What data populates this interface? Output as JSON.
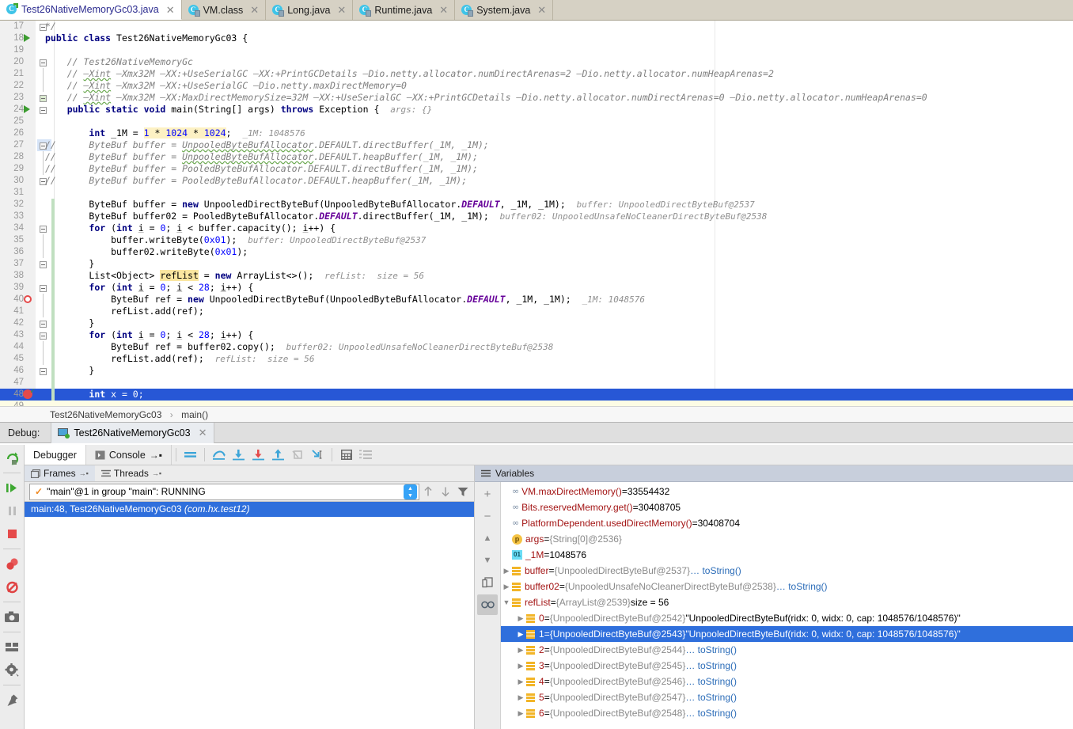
{
  "editor_tabs": [
    {
      "label": "Test26NativeMemoryGc03.java",
      "active": true,
      "icon": "java-class-run-icon"
    },
    {
      "label": "VM.class",
      "active": false,
      "icon": "java-class-icon"
    },
    {
      "label": "Long.java",
      "active": false,
      "icon": "java-class-icon"
    },
    {
      "label": "Runtime.java",
      "active": false,
      "icon": "java-class-icon"
    },
    {
      "label": "System.java",
      "active": false,
      "icon": "java-class-icon"
    }
  ],
  "code_lines": [
    {
      "num": "17",
      "mark": "",
      "fold": "end",
      "html": "<span class=\"cmt\">*/</span>"
    },
    {
      "num": "18",
      "mark": "run",
      "fold": "",
      "html": "<span class=\"kw\">public class</span> Test26NativeMemoryGc03 {"
    },
    {
      "num": "19",
      "mark": "",
      "fold": "",
      "html": ""
    },
    {
      "num": "20",
      "mark": "",
      "fold": "start",
      "html": "&nbsp;&nbsp;&nbsp;&nbsp;<span class=\"cmt\">// Test26NativeMemoryGc</span>"
    },
    {
      "num": "21",
      "mark": "",
      "fold": "line",
      "html": "&nbsp;&nbsp;&nbsp;&nbsp;<span class=\"cmt\">// <span class=\"sq\">–Xint</span> –Xmx32M –XX:+UseSerialGC –XX:+PrintGCDetails –Dio.netty.allocator.numDirectArenas=2 –Dio.netty.allocator.numHeapArenas=2</span>"
    },
    {
      "num": "22",
      "mark": "",
      "fold": "line",
      "html": "&nbsp;&nbsp;&nbsp;&nbsp;<span class=\"cmt\">// <span class=\"sq\">–Xint</span> –Xmx32M –XX:+UseSerialGC –Dio.netty.maxDirectMemory=0</span>"
    },
    {
      "num": "23",
      "mark": "",
      "fold": "endg",
      "html": "&nbsp;&nbsp;&nbsp;&nbsp;<span class=\"cmt\">// <span class=\"sq\">–Xint</span> –Xmx32M –XX:MaxDirectMemorySize=32M –XX:+UseSerialGC –XX:+PrintGCDetails –Dio.netty.allocator.numDirectArenas=0 –Dio.netty.allocator.numHeapArenas=0</span>"
    },
    {
      "num": "24",
      "mark": "run",
      "fold": "start",
      "html": "&nbsp;&nbsp;&nbsp;&nbsp;<span class=\"kw\">public static void</span> main(String[] args) <span class=\"kw\">throws</span> Exception {&nbsp;&nbsp;<span class=\"hint\">args: {}</span>"
    },
    {
      "num": "25",
      "mark": "",
      "fold": "",
      "html": ""
    },
    {
      "num": "26",
      "mark": "",
      "fold": "",
      "html": "&nbsp;&nbsp;&nbsp;&nbsp;&nbsp;&nbsp;&nbsp;&nbsp;<span class=\"kw\">int</span> _1M = <span class=\"hlbg\"><span class=\"num\">1</span> * <span class=\"num\">1024</span> * <span class=\"num\">1024</span></span>;&nbsp;&nbsp;<span class=\"hint\">_1M: 1048576</span>"
    },
    {
      "num": "27",
      "mark": "",
      "fold": "startsel",
      "html": "<span class=\"cmt\">//</span>&nbsp;&nbsp;&nbsp;&nbsp;&nbsp;&nbsp;<span class=\"cmt\">ByteBuf buffer = <span class=\"sq\">UnpooledByteBufAllocator</span>.DEFAULT.directBuffer(_1M, _1M);</span>"
    },
    {
      "num": "28",
      "mark": "",
      "fold": "line2",
      "html": "<span class=\"cmt\">//</span>&nbsp;&nbsp;&nbsp;&nbsp;&nbsp;&nbsp;<span class=\"cmt\">ByteBuf buffer = <span class=\"sq\">UnpooledByteBufAllocator</span>.DEFAULT.heapBuffer(_1M, _1M);</span>"
    },
    {
      "num": "29",
      "mark": "",
      "fold": "line2",
      "html": "<span class=\"cmt\">//</span>&nbsp;&nbsp;&nbsp;&nbsp;&nbsp;&nbsp;<span class=\"cmt\">ByteBuf buffer = PooledByteBufAllocator.DEFAULT.directBuffer(_1M, _1M);</span>"
    },
    {
      "num": "30",
      "mark": "",
      "fold": "end2",
      "html": "<span class=\"cmt\">//</span>&nbsp;&nbsp;&nbsp;&nbsp;&nbsp;&nbsp;<span class=\"cmt\">ByteBuf buffer = PooledByteBufAllocator.DEFAULT.heapBuffer(_1M, _1M);</span>"
    },
    {
      "num": "31",
      "mark": "",
      "fold": "",
      "html": ""
    },
    {
      "num": "32",
      "mark": "",
      "fold": "",
      "stripe": true,
      "html": "&nbsp;&nbsp;&nbsp;&nbsp;&nbsp;&nbsp;&nbsp;&nbsp;ByteBuf buffer = <span class=\"kw\">new</span> UnpooledDirectByteBuf(UnpooledByteBufAllocator.<span class=\"stat\">DEFAULT</span>, _1M, _1M);&nbsp;&nbsp;<span class=\"hint\">buffer: UnpooledDirectByteBuf@2537</span>"
    },
    {
      "num": "33",
      "mark": "",
      "fold": "",
      "stripe": true,
      "html": "&nbsp;&nbsp;&nbsp;&nbsp;&nbsp;&nbsp;&nbsp;&nbsp;ByteBuf buffer02 = PooledByteBufAllocator.<span class=\"stat\">DEFAULT</span>.directBuffer(_1M, _1M);&nbsp;&nbsp;<span class=\"hint\">buffer02: UnpooledUnsafeNoCleanerDirectByteBuf@2538</span>"
    },
    {
      "num": "34",
      "mark": "",
      "fold": "start",
      "stripe": true,
      "html": "&nbsp;&nbsp;&nbsp;&nbsp;&nbsp;&nbsp;&nbsp;&nbsp;<span class=\"kw\">for</span> (<span class=\"kw\">int</span> <span class=\"var-u\">i</span> = <span class=\"num\">0</span>; <span class=\"var-u\">i</span> &lt; buffer.capacity(); <span class=\"var-u\">i</span>++) {"
    },
    {
      "num": "35",
      "mark": "",
      "fold": "line",
      "stripe": true,
      "html": "&nbsp;&nbsp;&nbsp;&nbsp;&nbsp;&nbsp;&nbsp;&nbsp;&nbsp;&nbsp;&nbsp;&nbsp;buffer.writeByte(<span class=\"num\">0x01</span>);&nbsp;&nbsp;<span class=\"hint\">buffer: UnpooledDirectByteBuf@2537</span>"
    },
    {
      "num": "36",
      "mark": "",
      "fold": "line",
      "stripe": true,
      "html": "&nbsp;&nbsp;&nbsp;&nbsp;&nbsp;&nbsp;&nbsp;&nbsp;&nbsp;&nbsp;&nbsp;&nbsp;buffer02.writeByte(<span class=\"num\">0x01</span>);"
    },
    {
      "num": "37",
      "mark": "",
      "fold": "end",
      "stripe": true,
      "html": "&nbsp;&nbsp;&nbsp;&nbsp;&nbsp;&nbsp;&nbsp;&nbsp;}"
    },
    {
      "num": "38",
      "mark": "",
      "fold": "",
      "stripe": true,
      "html": "&nbsp;&nbsp;&nbsp;&nbsp;&nbsp;&nbsp;&nbsp;&nbsp;List&lt;Object&gt; <span class=\"searchbg\">refList</span> = <span class=\"kw\">new</span> ArrayList&lt;&gt;();&nbsp;&nbsp;<span class=\"hint\">refList:&nbsp;&nbsp;size = 56</span>"
    },
    {
      "num": "39",
      "mark": "",
      "fold": "start",
      "stripe": true,
      "html": "&nbsp;&nbsp;&nbsp;&nbsp;&nbsp;&nbsp;&nbsp;&nbsp;<span class=\"kw\">for</span> (<span class=\"kw\">int</span> <span class=\"var-u\">i</span> = <span class=\"num\">0</span>; <span class=\"var-u\">i</span> &lt; <span class=\"num\">28</span>; <span class=\"var-u\">i</span>++) {"
    },
    {
      "num": "40",
      "mark": "bp-dis",
      "fold": "line",
      "stripe": true,
      "html": "&nbsp;&nbsp;&nbsp;&nbsp;&nbsp;&nbsp;&nbsp;&nbsp;&nbsp;&nbsp;&nbsp;&nbsp;ByteBuf ref = <span class=\"kw\">new</span> UnpooledDirectByteBuf(UnpooledByteBufAllocator.<span class=\"stat\">DEFAULT</span>, _1M, _1M);&nbsp;&nbsp;<span class=\"hint\">_1M: 1048576</span>"
    },
    {
      "num": "41",
      "mark": "",
      "fold": "line",
      "stripe": true,
      "html": "&nbsp;&nbsp;&nbsp;&nbsp;&nbsp;&nbsp;&nbsp;&nbsp;&nbsp;&nbsp;&nbsp;&nbsp;refList.add(ref);"
    },
    {
      "num": "42",
      "mark": "",
      "fold": "end",
      "stripe": true,
      "html": "&nbsp;&nbsp;&nbsp;&nbsp;&nbsp;&nbsp;&nbsp;&nbsp;}"
    },
    {
      "num": "43",
      "mark": "",
      "fold": "start",
      "stripe": true,
      "html": "&nbsp;&nbsp;&nbsp;&nbsp;&nbsp;&nbsp;&nbsp;&nbsp;<span class=\"kw\">for</span> (<span class=\"kw\">int</span> <span class=\"var-u\">i</span> = <span class=\"num\">0</span>; <span class=\"var-u\">i</span> &lt; <span class=\"num\">28</span>; <span class=\"var-u\">i</span>++) {"
    },
    {
      "num": "44",
      "mark": "",
      "fold": "line",
      "stripe": true,
      "html": "&nbsp;&nbsp;&nbsp;&nbsp;&nbsp;&nbsp;&nbsp;&nbsp;&nbsp;&nbsp;&nbsp;&nbsp;ByteBuf ref = buffer02.copy();&nbsp;&nbsp;<span class=\"hint\">buffer02: UnpooledUnsafeNoCleanerDirectByteBuf@2538</span>"
    },
    {
      "num": "45",
      "mark": "",
      "fold": "line",
      "stripe": true,
      "html": "&nbsp;&nbsp;&nbsp;&nbsp;&nbsp;&nbsp;&nbsp;&nbsp;&nbsp;&nbsp;&nbsp;&nbsp;refList.add(ref);&nbsp;&nbsp;<span class=\"hint\">refList:&nbsp;&nbsp;size = 56</span>"
    },
    {
      "num": "46",
      "mark": "",
      "fold": "end",
      "stripe": true,
      "html": "&nbsp;&nbsp;&nbsp;&nbsp;&nbsp;&nbsp;&nbsp;&nbsp;}"
    },
    {
      "num": "47",
      "mark": "",
      "fold": "",
      "stripe": true,
      "html": ""
    },
    {
      "num": "48",
      "mark": "bp-on",
      "fold": "",
      "stripe": true,
      "hl": true,
      "html": "&nbsp;&nbsp;&nbsp;&nbsp;&nbsp;&nbsp;&nbsp;&nbsp;<span class=\"kw\">int</span> x = <span class=\"num\">0</span>;"
    },
    {
      "num": "49",
      "mark": "",
      "fold": "",
      "caret": true,
      "html": ""
    }
  ],
  "breadcrumb": {
    "class": "Test26NativeMemoryGc03",
    "separator": "›",
    "method": "main()"
  },
  "debug_header": {
    "label": "Debug:",
    "run_config": "Test26NativeMemoryGc03",
    "close": "✕"
  },
  "side_toolbar": [
    {
      "name": "rerun-button",
      "icon": "rerun-icon"
    },
    {
      "name": "resume-program-button",
      "icon": "resume-icon"
    },
    {
      "name": "pause-program-button",
      "icon": "pause-icon"
    },
    {
      "name": "stop-button",
      "icon": "stop-icon"
    },
    {
      "name": "view-breakpoints-button",
      "icon": "breakpoints-icon"
    },
    {
      "name": "mute-breakpoints-button",
      "icon": "mute-breakpoints-icon"
    },
    {
      "name": "camera-button",
      "icon": "camera-icon"
    },
    {
      "name": "layout-button",
      "icon": "layout-icon"
    },
    {
      "name": "settings-button",
      "icon": "gear-icon"
    },
    {
      "name": "pin-tab-button",
      "icon": "pin-icon"
    }
  ],
  "debug_tabs": [
    {
      "label": "Debugger",
      "active": true,
      "icon": ""
    },
    {
      "label": "Console",
      "active": false,
      "icon": "console-icon",
      "pin": "→▪"
    }
  ],
  "debug_toolbar": [
    {
      "name": "show-execution-point-button",
      "icon": "execution-point-icon"
    },
    {
      "name": "step-over-button",
      "icon": "step-over-icon"
    },
    {
      "name": "step-into-button",
      "icon": "step-into-icon"
    },
    {
      "name": "force-step-into-button",
      "icon": "force-step-into-icon"
    },
    {
      "name": "step-out-button",
      "icon": "step-out-icon"
    },
    {
      "name": "drop-frame-button",
      "icon": "drop-frame-icon"
    },
    {
      "name": "run-to-cursor-button",
      "icon": "run-to-cursor-icon"
    },
    {
      "name": "evaluate-expression-button",
      "icon": "calculator-icon"
    },
    {
      "name": "trace-button",
      "icon": "trace-icon"
    }
  ],
  "frames_pane": {
    "subtabs": [
      {
        "label": "Frames",
        "active": true,
        "icon": "frames-icon",
        "pin": "→▪"
      },
      {
        "label": "Threads",
        "active": false,
        "icon": "threads-icon",
        "pin": "→▪"
      }
    ],
    "thread_selector": {
      "value": "\"main\"@1 in group \"main\": RUNNING",
      "status_icon": "check-icon"
    },
    "thread_toolbar": [
      {
        "name": "move-up-button",
        "icon": "arrow-up-icon"
      },
      {
        "name": "move-down-button",
        "icon": "arrow-down-icon"
      },
      {
        "name": "filter-button",
        "icon": "filter-icon"
      }
    ],
    "frames": [
      {
        "location": "main:48, Test26NativeMemoryGc03",
        "package": "(com.hx.test12)",
        "selected": true
      }
    ]
  },
  "variables_pane": {
    "title": "Variables",
    "title_icon": "list-icon",
    "toolbar": [
      {
        "name": "add-watch-button",
        "label": "+"
      },
      {
        "name": "remove-watch-button",
        "label": "−"
      },
      {
        "name": "move-watch-up-button",
        "label": "▲"
      },
      {
        "name": "move-watch-down-button",
        "label": "▼"
      },
      {
        "name": "copy-value-button",
        "label": "copy-icon"
      },
      {
        "name": "inspect-button",
        "label": "inspect-icon",
        "selected": true
      }
    ],
    "rows": [
      {
        "indent": 0,
        "expand": "",
        "icon": "watch-icon",
        "name": "VM.maxDirectMemory()",
        "eq": " = ",
        "value": "33554432",
        "value_class": "vsize"
      },
      {
        "indent": 0,
        "expand": "",
        "icon": "watch-icon",
        "name": "Bits.reservedMemory.get()",
        "eq": " = ",
        "value": "30408705",
        "value_class": "vsize"
      },
      {
        "indent": 0,
        "expand": "",
        "icon": "watch-icon",
        "name": "PlatformDependent.usedDirectMemory()",
        "eq": " = ",
        "value": "30408704",
        "value_class": "vsize"
      },
      {
        "indent": 0,
        "expand": "",
        "icon": "param-icon",
        "name": "args",
        "eq": " = ",
        "value": "{String[0]@2536}",
        "value_class": "vval"
      },
      {
        "indent": 0,
        "expand": "",
        "icon": "primitive-icon",
        "name": "_1M",
        "eq": " = ",
        "value": "1048576",
        "value_class": "vsize"
      },
      {
        "indent": 0,
        "expand": "collapsed",
        "icon": "object-icon",
        "name": "buffer",
        "eq": " = ",
        "value": "{UnpooledDirectByteBuf@2537}",
        "value_class": "vval",
        "link": "… toString()"
      },
      {
        "indent": 0,
        "expand": "collapsed",
        "icon": "object-icon",
        "name": "buffer02",
        "eq": " = ",
        "value": "{UnpooledUnsafeNoCleanerDirectByteBuf@2538}",
        "value_class": "vval",
        "link": "… toString()"
      },
      {
        "indent": 0,
        "expand": "expanded",
        "icon": "object-icon",
        "name": "refList",
        "eq": " = ",
        "value": "{ArrayList@2539}",
        "value_class": "vval",
        "size": "size = 56"
      },
      {
        "indent": 1,
        "expand": "collapsed",
        "icon": "object-icon",
        "name": "0",
        "eq": " = ",
        "value": "{UnpooledDirectByteBuf@2542}",
        "value_class": "vval",
        "str": "\"UnpooledDirectByteBuf(ridx: 0, widx: 0, cap: 1048576/1048576)\""
      },
      {
        "indent": 1,
        "expand": "collapsed",
        "icon": "object-icon",
        "name": "1",
        "eq": " = ",
        "value": "{UnpooledDirectByteBuf@2543}",
        "value_class": "vval",
        "str": "\"UnpooledDirectByteBuf(ridx: 0, widx: 0, cap: 1048576/1048576)\"",
        "selected": true
      },
      {
        "indent": 1,
        "expand": "collapsed",
        "icon": "object-icon",
        "name": "2",
        "eq": " = ",
        "value": "{UnpooledDirectByteBuf@2544}",
        "value_class": "vval",
        "link": "… toString()"
      },
      {
        "indent": 1,
        "expand": "collapsed",
        "icon": "object-icon",
        "name": "3",
        "eq": " = ",
        "value": "{UnpooledDirectByteBuf@2545}",
        "value_class": "vval",
        "link": "… toString()"
      },
      {
        "indent": 1,
        "expand": "collapsed",
        "icon": "object-icon",
        "name": "4",
        "eq": " = ",
        "value": "{UnpooledDirectByteBuf@2546}",
        "value_class": "vval",
        "link": "… toString()"
      },
      {
        "indent": 1,
        "expand": "collapsed",
        "icon": "object-icon",
        "name": "5",
        "eq": " = ",
        "value": "{UnpooledDirectByteBuf@2547}",
        "value_class": "vval",
        "link": "… toString()"
      },
      {
        "indent": 1,
        "expand": "collapsed",
        "icon": "object-icon",
        "name": "6",
        "eq": " = ",
        "value": "{UnpooledDirectByteBuf@2548}",
        "value_class": "vval",
        "link": "… toString()"
      }
    ]
  },
  "colors": {
    "selection_blue": "#2f6fdc",
    "code_highlight": "#2757d6",
    "keyword": "#000080",
    "comment": "#808080",
    "number": "#0000ff",
    "var_name_red": "#a31515",
    "link_blue": "#2b6cb8",
    "tabbar_bg": "#d6d1c4",
    "breakpoint_red": "#e54a4a",
    "run_green": "#3c9c30"
  }
}
